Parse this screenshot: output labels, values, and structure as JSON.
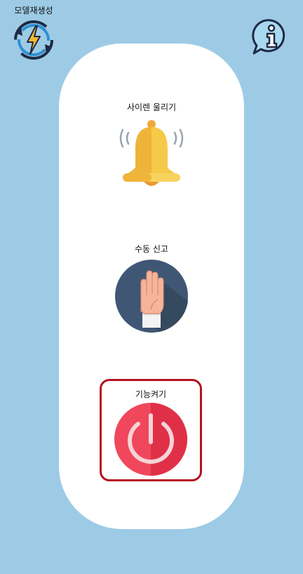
{
  "header": {
    "regenerate_label": "모델재생성",
    "regenerate_icon": "refresh-lightning-icon",
    "info_icon": "info-bubble-icon"
  },
  "actions": {
    "siren_label": "사이렌 울리기",
    "siren_icon": "bell-icon",
    "manual_report_label": "수동 신고",
    "manual_report_icon": "raised-hand-icon",
    "power_label": "기능켜기",
    "power_icon": "power-icon"
  },
  "colors": {
    "background": "#9dcbe6",
    "panel": "#ffffff",
    "highlight_border": "#b3121f",
    "power_red": "#f0475c",
    "bell_yellow": "#f7c948",
    "hand_circle": "#3f5775"
  }
}
